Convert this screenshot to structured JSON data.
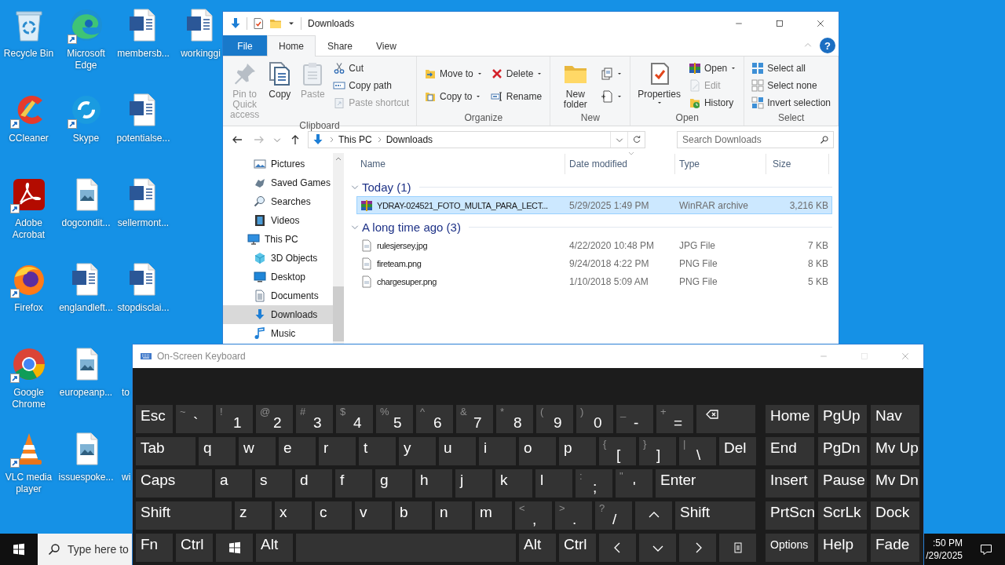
{
  "desktop": {
    "icons": [
      {
        "label": "Recycle Bin",
        "kind": "recycle",
        "shortcut": false
      },
      {
        "label": "CCleaner",
        "kind": "ccleaner",
        "shortcut": true
      },
      {
        "label": "Adobe Acrobat",
        "kind": "acrobat",
        "shortcut": true
      },
      {
        "label": "Firefox",
        "kind": "firefox",
        "shortcut": true
      },
      {
        "label": "Google Chrome",
        "kind": "chrome",
        "shortcut": true
      },
      {
        "label": "VLC media player",
        "kind": "vlc",
        "shortcut": true
      },
      {
        "label": "Microsoft Edge",
        "kind": "edge",
        "shortcut": true
      },
      {
        "label": "Skype",
        "kind": "skype",
        "shortcut": true
      },
      {
        "label": "dogcondit...",
        "kind": "image",
        "shortcut": false
      },
      {
        "label": "englandleft...",
        "kind": "word",
        "shortcut": false
      },
      {
        "label": "europeanp...",
        "kind": "image",
        "shortcut": false
      },
      {
        "label": "issuespoke...",
        "kind": "image",
        "shortcut": false
      },
      {
        "label": "membersb...",
        "kind": "word",
        "shortcut": false
      },
      {
        "label": "potentialse...",
        "kind": "word",
        "shortcut": false
      },
      {
        "label": "sellermont...",
        "kind": "word",
        "shortcut": false
      },
      {
        "label": "stopdisclai...",
        "kind": "word",
        "shortcut": false
      },
      {
        "label": "to",
        "kind": "covered",
        "shortcut": false
      },
      {
        "label": "wi",
        "kind": "covered",
        "shortcut": false
      },
      {
        "label": "workinggi",
        "kind": "word",
        "shortcut": false
      }
    ]
  },
  "explorer": {
    "title": "Downloads",
    "help": "?",
    "ribbon_tabs": [
      {
        "label": "File",
        "kind": "file",
        "selected": false
      },
      {
        "label": "Home",
        "kind": "tab",
        "selected": true
      },
      {
        "label": "Share",
        "kind": "tab",
        "selected": false
      },
      {
        "label": "View",
        "kind": "tab",
        "selected": false
      }
    ],
    "ribbon_groups": [
      {
        "label": "Clipboard",
        "items": [
          {
            "kind": "large",
            "label": "Pin to Quick access",
            "disabled": true,
            "dropdown": false
          },
          {
            "kind": "large",
            "label": "Copy",
            "disabled": false,
            "dropdown": false
          },
          {
            "kind": "large",
            "label": "Paste",
            "disabled": true,
            "dropdown": false
          },
          {
            "kind": "stack",
            "items": [
              {
                "label": "Cut",
                "disabled": false,
                "dropdown": false
              },
              {
                "label": "Copy path",
                "disabled": false,
                "dropdown": false
              },
              {
                "label": "Paste shortcut",
                "disabled": true,
                "dropdown": false
              }
            ]
          }
        ]
      },
      {
        "label": "Organize",
        "items": [
          {
            "kind": "stack",
            "items": [
              {
                "label": "Move to",
                "disabled": false,
                "dropdown": true
              },
              {
                "label": "Copy to",
                "disabled": false,
                "dropdown": true
              }
            ]
          },
          {
            "kind": "stack",
            "items": [
              {
                "label": "Delete",
                "disabled": false,
                "dropdown": true
              },
              {
                "label": "Rename",
                "disabled": false,
                "dropdown": false
              }
            ]
          }
        ]
      },
      {
        "label": "New",
        "items": [
          {
            "kind": "large",
            "label": "New folder",
            "disabled": false,
            "dropdown": false
          },
          {
            "kind": "stack",
            "items": [
              {
                "disabled": false,
                "dropdown": true
              },
              {
                "disabled": false,
                "dropdown": true
              }
            ]
          }
        ]
      },
      {
        "label": "Open",
        "items": [
          {
            "kind": "large",
            "label": "Properties",
            "disabled": false,
            "dropdown": true
          },
          {
            "kind": "stack",
            "items": [
              {
                "label": "Open",
                "disabled": false,
                "dropdown": true
              },
              {
                "label": "Edit",
                "disabled": true,
                "dropdown": false
              },
              {
                "label": "History",
                "disabled": false,
                "dropdown": false
              }
            ]
          }
        ]
      },
      {
        "label": "Select",
        "items": [
          {
            "kind": "stack",
            "items": [
              {
                "label": "Select all",
                "disabled": false,
                "dropdown": false
              },
              {
                "label": "Select none",
                "disabled": false,
                "dropdown": false
              },
              {
                "label": "Invert selection",
                "disabled": false,
                "dropdown": false
              }
            ]
          }
        ]
      }
    ],
    "address": {
      "crumbs": [
        "This PC",
        "Downloads"
      ]
    },
    "search": {
      "placeholder": "Search Downloads"
    },
    "nav_pane": {
      "items": [
        {
          "label": "Pictures",
          "selected": false
        },
        {
          "label": "Saved Games",
          "selected": false
        },
        {
          "label": "Searches",
          "selected": false
        },
        {
          "label": "Videos",
          "selected": false
        }
      ],
      "tree": [
        {
          "label": "This PC",
          "selected": false,
          "children": [
            {
              "label": "3D Objects",
              "selected": false
            },
            {
              "label": "Desktop",
              "selected": false
            },
            {
              "label": "Documents",
              "selected": false
            },
            {
              "label": "Downloads",
              "selected": true
            },
            {
              "label": "Music",
              "selected": false
            }
          ]
        }
      ]
    },
    "columns": [
      {
        "label": "Name",
        "sorted": false
      },
      {
        "label": "Date modified",
        "sorted": true
      },
      {
        "label": "Type",
        "sorted": false
      },
      {
        "label": "Size",
        "sorted": false
      }
    ],
    "groups": [
      {
        "label": "Today (1)",
        "expanded": true,
        "files": [
          {
            "name": "YDRAY-024521_FOTO_MULTA_PARA_LECT...",
            "date": "5/29/2025 1:49 PM",
            "type": "WinRAR archive",
            "size": "3,216 KB",
            "kind": "archive",
            "selected": true
          }
        ]
      },
      {
        "label": "A long time ago (3)",
        "expanded": true,
        "files": [
          {
            "name": "rulesjersey.jpg",
            "date": "4/22/2020 10:48 PM",
            "type": "JPG File",
            "size": "7 KB",
            "kind": "file",
            "selected": false
          },
          {
            "name": "fireteam.png",
            "date": "9/24/2018 4:22 PM",
            "type": "PNG File",
            "size": "8 KB",
            "kind": "file",
            "selected": false
          },
          {
            "name": "chargesuper.png",
            "date": "1/10/2018 5:09 AM",
            "type": "PNG File",
            "size": "5 KB",
            "kind": "file",
            "selected": false
          }
        ]
      }
    ]
  },
  "keyboard": {
    "title": "On-Screen Keyboard",
    "main_rows": [
      [
        {
          "kind": "key",
          "label": "Esc"
        },
        {
          "kind": "symbol",
          "shift": "~",
          "label": "`"
        },
        {
          "kind": "symbol",
          "shift": "!",
          "label": "1"
        },
        {
          "kind": "symbol",
          "shift": "@",
          "label": "2"
        },
        {
          "kind": "symbol",
          "shift": "#",
          "label": "3"
        },
        {
          "kind": "symbol",
          "shift": "$",
          "label": "4"
        },
        {
          "kind": "symbol",
          "shift": "%",
          "label": "5"
        },
        {
          "kind": "symbol",
          "shift": "^",
          "label": "6"
        },
        {
          "kind": "symbol",
          "shift": "&",
          "label": "7"
        },
        {
          "kind": "symbol",
          "shift": "*",
          "label": "8"
        },
        {
          "kind": "symbol",
          "shift": "(",
          "label": "9"
        },
        {
          "kind": "symbol",
          "shift": ")",
          "label": "0"
        },
        {
          "kind": "symbol",
          "shift": "_",
          "label": "-"
        },
        {
          "kind": "symbol",
          "shift": "+",
          "label": "="
        },
        {
          "kind": "backspace"
        }
      ],
      [
        {
          "kind": "tab",
          "label": "Tab"
        },
        {
          "kind": "key",
          "label": "q"
        },
        {
          "kind": "key",
          "label": "w"
        },
        {
          "kind": "key",
          "label": "e"
        },
        {
          "kind": "key",
          "label": "r"
        },
        {
          "kind": "key",
          "label": "t"
        },
        {
          "kind": "key",
          "label": "y"
        },
        {
          "kind": "key",
          "label": "u"
        },
        {
          "kind": "key",
          "label": "i"
        },
        {
          "kind": "key",
          "label": "o"
        },
        {
          "kind": "key",
          "label": "p"
        },
        {
          "kind": "symbol",
          "shift": "{",
          "label": "["
        },
        {
          "kind": "symbol",
          "shift": "}",
          "label": "]"
        },
        {
          "kind": "symbol",
          "shift": "|",
          "label": "\\"
        },
        {
          "kind": "key",
          "label": "Del"
        }
      ],
      [
        {
          "kind": "caps",
          "label": "Caps"
        },
        {
          "kind": "key",
          "label": "a"
        },
        {
          "kind": "key",
          "label": "s"
        },
        {
          "kind": "key",
          "label": "d"
        },
        {
          "kind": "key",
          "label": "f"
        },
        {
          "kind": "key",
          "label": "g"
        },
        {
          "kind": "key",
          "label": "h"
        },
        {
          "kind": "key",
          "label": "j"
        },
        {
          "kind": "key",
          "label": "k"
        },
        {
          "kind": "key",
          "label": "l"
        },
        {
          "kind": "symbol",
          "shift": ":",
          "label": ";"
        },
        {
          "kind": "symbol",
          "shift": "\"",
          "label": "'"
        },
        {
          "kind": "enter",
          "label": "Enter"
        }
      ],
      [
        {
          "kind": "lshift",
          "label": "Shift"
        },
        {
          "kind": "key",
          "label": "z"
        },
        {
          "kind": "key",
          "label": "x"
        },
        {
          "kind": "key",
          "label": "c"
        },
        {
          "kind": "key",
          "label": "v"
        },
        {
          "kind": "key",
          "label": "b"
        },
        {
          "kind": "key",
          "label": "n"
        },
        {
          "kind": "key",
          "label": "m"
        },
        {
          "kind": "symbol",
          "shift": "<",
          "label": ","
        },
        {
          "kind": "symbol",
          "shift": ">",
          "label": "."
        },
        {
          "kind": "symbol",
          "shift": "?",
          "label": "/"
        },
        {
          "kind": "uparrow"
        },
        {
          "kind": "rshift",
          "label": "Shift"
        }
      ],
      [
        {
          "kind": "key",
          "label": "Fn"
        },
        {
          "kind": "key",
          "label": "Ctrl"
        },
        {
          "kind": "windows"
        },
        {
          "kind": "key",
          "label": "Alt"
        },
        {
          "kind": "space"
        },
        {
          "kind": "key",
          "label": "Alt"
        },
        {
          "kind": "key",
          "label": "Ctrl"
        },
        {
          "kind": "leftarrow"
        },
        {
          "kind": "downarrow"
        },
        {
          "kind": "rightarrow"
        },
        {
          "kind": "menu"
        }
      ]
    ],
    "nav_rows": [
      [
        {
          "kind": "nav",
          "label": "Home"
        },
        {
          "kind": "nav",
          "label": "PgUp"
        },
        {
          "kind": "nav",
          "label": "Nav"
        }
      ],
      [
        {
          "kind": "nav",
          "label": "End"
        },
        {
          "kind": "nav",
          "label": "PgDn"
        },
        {
          "kind": "nav",
          "label": "Mv Up"
        }
      ],
      [
        {
          "kind": "nav",
          "label": "Insert"
        },
        {
          "kind": "nav",
          "label": "Pause"
        },
        {
          "kind": "nav",
          "label": "Mv Dn"
        }
      ],
      [
        {
          "kind": "nav",
          "label": "PrtScn"
        },
        {
          "kind": "nav",
          "label": "ScrLk"
        },
        {
          "kind": "nav",
          "label": "Dock"
        }
      ],
      [
        {
          "kind": "option",
          "label": "Options"
        },
        {
          "kind": "nav",
          "label": "Help"
        },
        {
          "kind": "nav",
          "label": "Fade"
        }
      ]
    ]
  },
  "taskbar": {
    "search_placeholder": "Type here to",
    "clock_time": ":50 PM",
    "clock_date": "/29/2025"
  }
}
